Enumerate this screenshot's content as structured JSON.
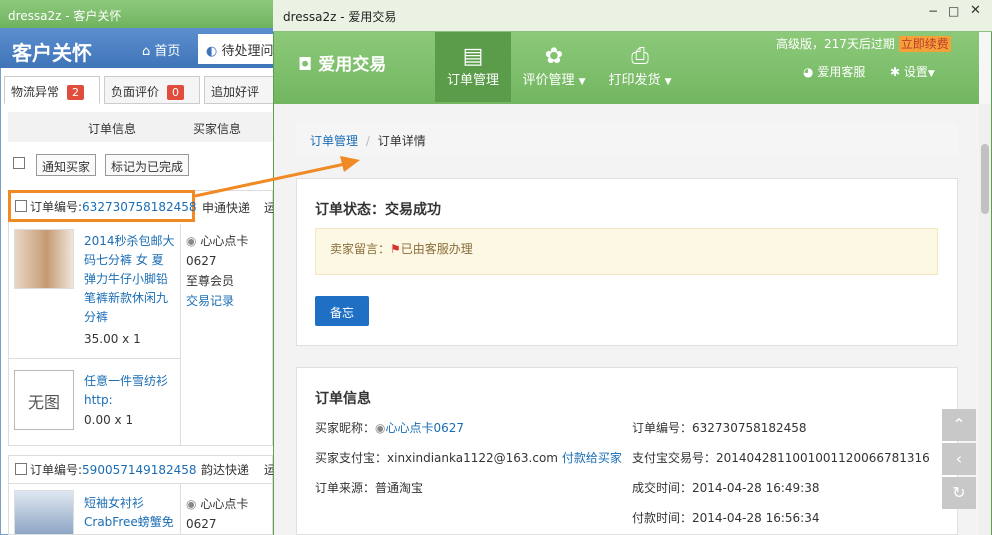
{
  "back_window": {
    "title": "dressa2z - 客户关怀",
    "header_title": "客户关怀",
    "home": "首页",
    "pending": "待处理问",
    "tabs": [
      {
        "label": "物流异常",
        "count": "2"
      },
      {
        "label": "负面评价",
        "count": "0"
      },
      {
        "label": "追加好评"
      }
    ],
    "col_headers": [
      "订单信息",
      "买家信息"
    ],
    "notify_label": "通知买家",
    "complete_label": "标记为已完成",
    "orders": [
      {
        "no_label": "订单编号:",
        "no": "632730758182458",
        "ship": "申通快递",
        "extra": "运",
        "items": [
          {
            "title_lines": [
              "2014秒杀包邮大",
              "码七分裤 女 夏",
              "弹力牛仔小脚铅",
              "笔裤新款休闲九",
              "分裤"
            ],
            "price": "35.00 x 1"
          },
          {
            "title_lines": [
              "任意一件雪纺衫",
              "http:"
            ],
            "price": "0.00 x 1",
            "noimg": "无图"
          }
        ],
        "buyer": [
          "心心点卡",
          "0627",
          "至尊会员",
          "交易记录"
        ]
      },
      {
        "no_label": "订单编号:",
        "no": "590057149182458",
        "ship": "韵达快递",
        "extra": "运",
        "items": [
          {
            "title_lines": [
              "短袖女衬衫",
              "CrabFree螃蟹免"
            ]
          }
        ],
        "buyer": [
          "心心点卡",
          "0627"
        ]
      }
    ]
  },
  "front_window": {
    "title": "dressa2z - 爱用交易",
    "logo": "爱用交易",
    "nav": [
      "订单管理",
      "评价管理",
      "打印发货"
    ],
    "top_info": "高级版，217天后过期",
    "renew": "立即续费",
    "service": "爱用客服",
    "settings": "设置",
    "breadcrumb": [
      "订单管理",
      "订单详情"
    ],
    "status_title": "订单状态：交易成功",
    "seller_note_label": "卖家留言：",
    "seller_note": "已由客服办理",
    "memo_button": "备忘",
    "info_title": "订单信息",
    "left": [
      {
        "k": "买家昵称：",
        "v": "心心点卡0627"
      },
      {
        "k": "买家支付宝：",
        "v": "xinxindianka1122@163.com",
        "link": "付款给买家"
      },
      {
        "k": "订单来源：",
        "v": "普通淘宝"
      }
    ],
    "right": [
      {
        "k": "订单编号：",
        "v": "632730758182458"
      },
      {
        "k": "支付宝交易号：",
        "v": "2014042811001001120066781316"
      },
      {
        "k": "成交时间：",
        "v": "2014-04-28 16:49:38"
      },
      {
        "k": "付款时间：",
        "v": "2014-04-28 16:56:34"
      }
    ]
  },
  "colors": {
    "accent_green": "#72b660",
    "link_blue": "#1a6db5",
    "highlight_orange": "#f08a24",
    "memo_blue": "#1f6fc4"
  }
}
